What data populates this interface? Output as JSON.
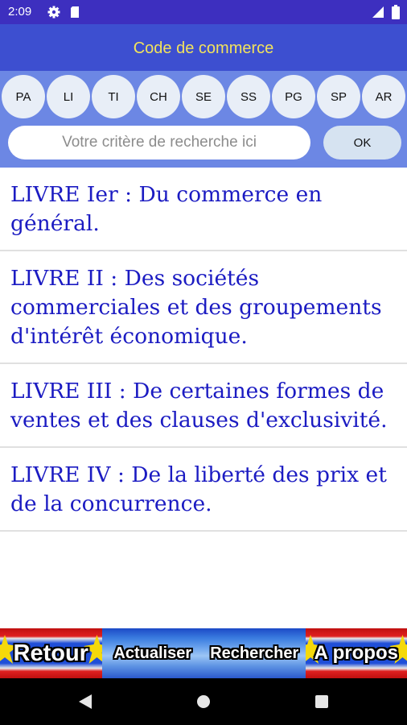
{
  "status_bar": {
    "time": "2:09",
    "icons": [
      "gear-icon",
      "sd-card-icon",
      "signal-icon",
      "battery-icon"
    ]
  },
  "app_bar": {
    "title": "Code de commerce"
  },
  "chips": [
    {
      "label": "PA"
    },
    {
      "label": "LI"
    },
    {
      "label": "TI"
    },
    {
      "label": "CH"
    },
    {
      "label": "SE"
    },
    {
      "label": "SS"
    },
    {
      "label": "PG"
    },
    {
      "label": "SP"
    },
    {
      "label": "AR"
    }
  ],
  "search": {
    "placeholder": "Votre critère de recherche ici",
    "value": "",
    "ok_label": "OK"
  },
  "list": [
    {
      "text": "LIVRE Ier : Du commerce en général."
    },
    {
      "text": "LIVRE II : Des sociétés commerciales et des groupements d'intérêt économique."
    },
    {
      "text": "LIVRE III : De certaines formes de ventes et des clauses d'exclusivité."
    },
    {
      "text": "LIVRE IV : De la liberté des prix et de la concurrence."
    }
  ],
  "bottom_buttons": [
    {
      "label": "Retour"
    },
    {
      "label": "Actualiser"
    },
    {
      "label": "Rechercher"
    },
    {
      "label": "A propos"
    }
  ],
  "nav_bar": {
    "icons": [
      "back-icon",
      "home-icon",
      "recents-icon"
    ]
  },
  "colors": {
    "status_bar": "#3d2fbf",
    "app_bar": "#3d4fd0",
    "title": "#f2e35c",
    "search_panel": "#6c87e4",
    "list_text": "#1b1bc2"
  }
}
